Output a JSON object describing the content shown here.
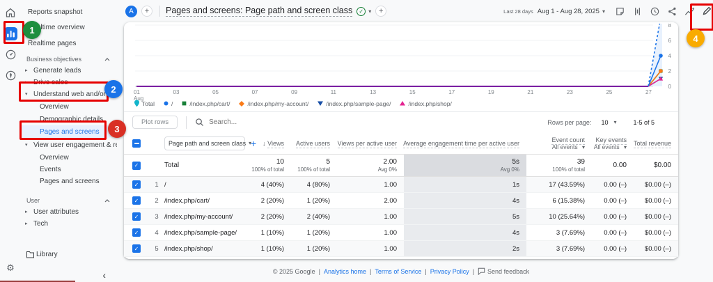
{
  "icons": {
    "sort_desc": "↓",
    "caret": "▾",
    "tri_right": "▸",
    "tri_down": "▾",
    "chevron_left": "‹",
    "gear": "⚙",
    "plus": "+",
    "check": "✓"
  },
  "rail": {
    "icons": [
      "home",
      "reports",
      "advertising",
      "explore",
      "settings"
    ]
  },
  "sidebar": {
    "items": [
      {
        "label": "Reports snapshot"
      },
      {
        "label": "Realtime overview"
      },
      {
        "label": "Realtime pages"
      },
      {
        "label": "Business objectives",
        "type": "section"
      },
      {
        "label": "Generate leads",
        "expanded": false
      },
      {
        "label": "Drive sales",
        "expanded": false
      },
      {
        "label": "Understand web and/or app t...",
        "expanded": true,
        "annotation": "2"
      },
      {
        "label": "Overview"
      },
      {
        "label": "Demographic details"
      },
      {
        "label": "Pages and screens",
        "selected": true,
        "annotation": "3"
      },
      {
        "label": "View user engagement & rete...",
        "expanded": true
      },
      {
        "label": "Overview"
      },
      {
        "label": "Events"
      },
      {
        "label": "Pages and screens"
      },
      {
        "label": "User",
        "type": "section"
      },
      {
        "label": "User attributes",
        "expanded": false
      },
      {
        "label": "Tech",
        "expanded": false
      },
      {
        "label": "Library"
      }
    ]
  },
  "topbar": {
    "avatar": "A",
    "title": "Pages and screens: Page path and screen class",
    "date_preset": "Last 28 days",
    "date_range": "Aug 1 - Aug 28, 2025",
    "icon_names": [
      "notes",
      "comparisons",
      "data-quality",
      "share",
      "insights",
      "edit"
    ]
  },
  "chart_data": {
    "type": "line",
    "x_axis": {
      "month": "Aug",
      "tick_labels": [
        "01",
        "03",
        "05",
        "07",
        "09",
        "11",
        "13",
        "15",
        "17",
        "19",
        "21",
        "23",
        "25",
        "27"
      ],
      "days_span": 28
    },
    "y_axis": {
      "ticks": [
        0,
        2,
        4,
        6,
        8
      ],
      "side": "right"
    },
    "flat_line_color": "#7b1fa2",
    "series": [
      {
        "name": "Total",
        "line_color": "#1a73e8",
        "legend_color": "#12b5cb",
        "marker": "pin",
        "line_style": "dashed",
        "start_value": 0,
        "end_value": 10
      },
      {
        "name": "/",
        "line_color": "#1a73e8",
        "legend_color": "#1a73e8",
        "marker": "circle",
        "line_style": "solid",
        "start_value": 0,
        "end_value": 4
      },
      {
        "name": "/index.php/cart/",
        "line_color": "#188038",
        "legend_color": "#188038",
        "marker": "square",
        "line_style": "solid",
        "start_value": 0,
        "end_value": 2
      },
      {
        "name": "/index.php/my-account/",
        "line_color": "#fa7b17",
        "legend_color": "#fa7b17",
        "marker": "diamond",
        "line_style": "solid",
        "start_value": 0,
        "end_value": 2
      },
      {
        "name": "/index.php/sample-page/",
        "line_color": "#174ea6",
        "legend_color": "#174ea6",
        "marker": "triangle-down",
        "line_style": "solid",
        "start_value": 0,
        "end_value": 1
      },
      {
        "name": "/index.php/shop/",
        "line_color": "#e52592",
        "legend_color": "#e52592",
        "marker": "triangle-up",
        "line_style": "solid",
        "start_value": 0,
        "end_value": 1
      }
    ]
  },
  "controls": {
    "plot_rows": "Plot rows",
    "search_placeholder": "Search...",
    "rows_per_page_label": "Rows per page:",
    "rows_per_page_value": "10",
    "range": "1-5 of 5"
  },
  "table": {
    "dimension": "Page path and screen class",
    "columns": {
      "views": "Views",
      "active_users": "Active users",
      "views_per_active_user": "Views per active user",
      "avg_engagement": "Average engagement time per active user",
      "event_count": "Event count",
      "key_events": "Key events",
      "total_revenue": "Total revenue",
      "all_events": "All events"
    },
    "totals": {
      "label": "Total",
      "views": "10",
      "views_sub": "100% of total",
      "active_users": "5",
      "active_users_sub": "100% of total",
      "views_per_user": "2.00",
      "views_per_user_sub": "Avg 0%",
      "engagement": "5s",
      "engagement_sub": "Avg 0%",
      "event_count": "39",
      "event_count_sub": "100% of total",
      "key_events": "0.00",
      "revenue": "$0.00"
    },
    "rows": [
      {
        "index": "1",
        "path": "/",
        "views": "4 (40%)",
        "active_users": "4 (80%)",
        "views_per_user": "1.00",
        "engagement": "1s",
        "event_count": "17 (43.59%)",
        "key_events": "0.00 (–)",
        "revenue": "$0.00 (–)"
      },
      {
        "index": "2",
        "path": "/index.php/cart/",
        "views": "2 (20%)",
        "active_users": "1 (20%)",
        "views_per_user": "2.00",
        "engagement": "4s",
        "event_count": "6 (15.38%)",
        "key_events": "0.00 (–)",
        "revenue": "$0.00 (–)"
      },
      {
        "index": "3",
        "path": "/index.php/my-account/",
        "views": "2 (20%)",
        "active_users": "2 (40%)",
        "views_per_user": "1.00",
        "engagement": "5s",
        "event_count": "10 (25.64%)",
        "key_events": "0.00 (–)",
        "revenue": "$0.00 (–)"
      },
      {
        "index": "4",
        "path": "/index.php/sample-page/",
        "views": "1 (10%)",
        "active_users": "1 (20%)",
        "views_per_user": "1.00",
        "engagement": "4s",
        "event_count": "3 (7.69%)",
        "key_events": "0.00 (–)",
        "revenue": "$0.00 (–)"
      },
      {
        "index": "5",
        "path": "/index.php/shop/",
        "views": "1 (10%)",
        "active_users": "1 (20%)",
        "views_per_user": "1.00",
        "engagement": "2s",
        "event_count": "3 (7.69%)",
        "key_events": "0.00 (–)",
        "revenue": "$0.00 (–)"
      }
    ]
  },
  "footer": {
    "copyright": "© 2025 Google",
    "separator": "|",
    "links": [
      "Analytics home",
      "Terms of Service",
      "Privacy Policy"
    ],
    "send_feedback": "Send feedback"
  },
  "annotations": {
    "highlight_color": "#e60000",
    "markers": [
      {
        "label": "1",
        "color": "#1e8e3e"
      },
      {
        "label": "2",
        "color": "#1a73e8"
      },
      {
        "label": "3",
        "color": "#d93025"
      },
      {
        "label": "4",
        "color": "#f9ab00"
      }
    ]
  }
}
